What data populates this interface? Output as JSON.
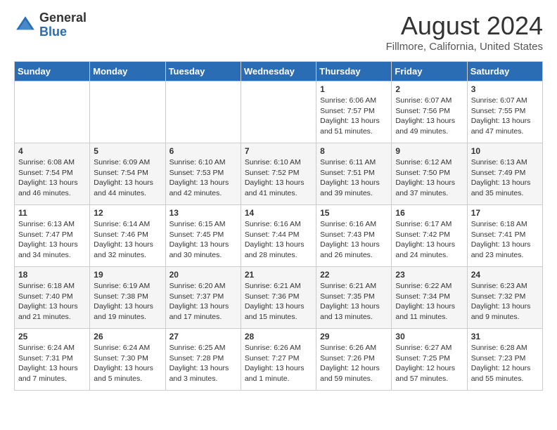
{
  "header": {
    "logo_general": "General",
    "logo_blue": "Blue",
    "month_title": "August 2024",
    "location": "Fillmore, California, United States"
  },
  "days_of_week": [
    "Sunday",
    "Monday",
    "Tuesday",
    "Wednesday",
    "Thursday",
    "Friday",
    "Saturday"
  ],
  "weeks": [
    [
      {
        "day": "",
        "content": ""
      },
      {
        "day": "",
        "content": ""
      },
      {
        "day": "",
        "content": ""
      },
      {
        "day": "",
        "content": ""
      },
      {
        "day": "1",
        "content": "Sunrise: 6:06 AM\nSunset: 7:57 PM\nDaylight: 13 hours\nand 51 minutes."
      },
      {
        "day": "2",
        "content": "Sunrise: 6:07 AM\nSunset: 7:56 PM\nDaylight: 13 hours\nand 49 minutes."
      },
      {
        "day": "3",
        "content": "Sunrise: 6:07 AM\nSunset: 7:55 PM\nDaylight: 13 hours\nand 47 minutes."
      }
    ],
    [
      {
        "day": "4",
        "content": "Sunrise: 6:08 AM\nSunset: 7:54 PM\nDaylight: 13 hours\nand 46 minutes."
      },
      {
        "day": "5",
        "content": "Sunrise: 6:09 AM\nSunset: 7:54 PM\nDaylight: 13 hours\nand 44 minutes."
      },
      {
        "day": "6",
        "content": "Sunrise: 6:10 AM\nSunset: 7:53 PM\nDaylight: 13 hours\nand 42 minutes."
      },
      {
        "day": "7",
        "content": "Sunrise: 6:10 AM\nSunset: 7:52 PM\nDaylight: 13 hours\nand 41 minutes."
      },
      {
        "day": "8",
        "content": "Sunrise: 6:11 AM\nSunset: 7:51 PM\nDaylight: 13 hours\nand 39 minutes."
      },
      {
        "day": "9",
        "content": "Sunrise: 6:12 AM\nSunset: 7:50 PM\nDaylight: 13 hours\nand 37 minutes."
      },
      {
        "day": "10",
        "content": "Sunrise: 6:13 AM\nSunset: 7:49 PM\nDaylight: 13 hours\nand 35 minutes."
      }
    ],
    [
      {
        "day": "11",
        "content": "Sunrise: 6:13 AM\nSunset: 7:47 PM\nDaylight: 13 hours\nand 34 minutes."
      },
      {
        "day": "12",
        "content": "Sunrise: 6:14 AM\nSunset: 7:46 PM\nDaylight: 13 hours\nand 32 minutes."
      },
      {
        "day": "13",
        "content": "Sunrise: 6:15 AM\nSunset: 7:45 PM\nDaylight: 13 hours\nand 30 minutes."
      },
      {
        "day": "14",
        "content": "Sunrise: 6:16 AM\nSunset: 7:44 PM\nDaylight: 13 hours\nand 28 minutes."
      },
      {
        "day": "15",
        "content": "Sunrise: 6:16 AM\nSunset: 7:43 PM\nDaylight: 13 hours\nand 26 minutes."
      },
      {
        "day": "16",
        "content": "Sunrise: 6:17 AM\nSunset: 7:42 PM\nDaylight: 13 hours\nand 24 minutes."
      },
      {
        "day": "17",
        "content": "Sunrise: 6:18 AM\nSunset: 7:41 PM\nDaylight: 13 hours\nand 23 minutes."
      }
    ],
    [
      {
        "day": "18",
        "content": "Sunrise: 6:18 AM\nSunset: 7:40 PM\nDaylight: 13 hours\nand 21 minutes."
      },
      {
        "day": "19",
        "content": "Sunrise: 6:19 AM\nSunset: 7:38 PM\nDaylight: 13 hours\nand 19 minutes."
      },
      {
        "day": "20",
        "content": "Sunrise: 6:20 AM\nSunset: 7:37 PM\nDaylight: 13 hours\nand 17 minutes."
      },
      {
        "day": "21",
        "content": "Sunrise: 6:21 AM\nSunset: 7:36 PM\nDaylight: 13 hours\nand 15 minutes."
      },
      {
        "day": "22",
        "content": "Sunrise: 6:21 AM\nSunset: 7:35 PM\nDaylight: 13 hours\nand 13 minutes."
      },
      {
        "day": "23",
        "content": "Sunrise: 6:22 AM\nSunset: 7:34 PM\nDaylight: 13 hours\nand 11 minutes."
      },
      {
        "day": "24",
        "content": "Sunrise: 6:23 AM\nSunset: 7:32 PM\nDaylight: 13 hours\nand 9 minutes."
      }
    ],
    [
      {
        "day": "25",
        "content": "Sunrise: 6:24 AM\nSunset: 7:31 PM\nDaylight: 13 hours\nand 7 minutes."
      },
      {
        "day": "26",
        "content": "Sunrise: 6:24 AM\nSunset: 7:30 PM\nDaylight: 13 hours\nand 5 minutes."
      },
      {
        "day": "27",
        "content": "Sunrise: 6:25 AM\nSunset: 7:28 PM\nDaylight: 13 hours\nand 3 minutes."
      },
      {
        "day": "28",
        "content": "Sunrise: 6:26 AM\nSunset: 7:27 PM\nDaylight: 13 hours\nand 1 minute."
      },
      {
        "day": "29",
        "content": "Sunrise: 6:26 AM\nSunset: 7:26 PM\nDaylight: 12 hours\nand 59 minutes."
      },
      {
        "day": "30",
        "content": "Sunrise: 6:27 AM\nSunset: 7:25 PM\nDaylight: 12 hours\nand 57 minutes."
      },
      {
        "day": "31",
        "content": "Sunrise: 6:28 AM\nSunset: 7:23 PM\nDaylight: 12 hours\nand 55 minutes."
      }
    ]
  ]
}
